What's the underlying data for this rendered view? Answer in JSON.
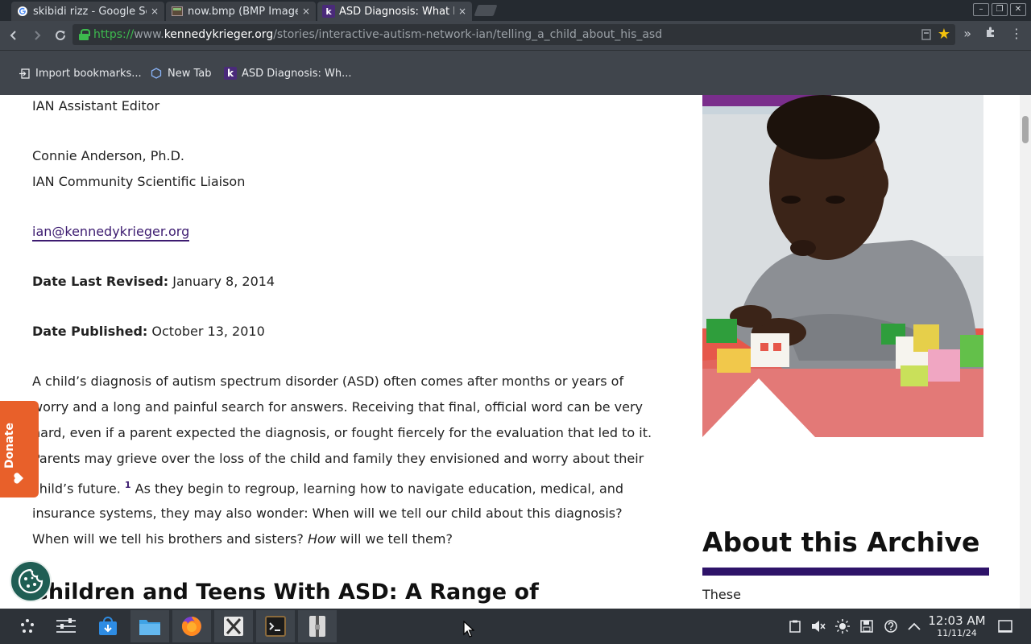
{
  "tabs": [
    {
      "title": "skibidi rizz - Google Se",
      "icon": "google-icon",
      "close": "×"
    },
    {
      "title": "now.bmp (BMP Image",
      "icon": "image-file-icon",
      "close": "×"
    },
    {
      "title": "ASD Diagnosis: What I",
      "icon": "kennedy-krieger-icon",
      "icon_glyph": "k",
      "close": "×"
    }
  ],
  "window_controls": {
    "minimize": "–",
    "restore": "❐",
    "close": "✕"
  },
  "address_bar": {
    "scheme": "https://",
    "domain_prefix": "www.",
    "domain": "kennedykrieger.org",
    "path": "/stories/interactive-autism-network-ian/telling_a_child_about_his_asd"
  },
  "bookmarks": [
    {
      "label": "Import bookmarks...",
      "icon": "import-icon"
    },
    {
      "label": "New Tab",
      "icon": "new-tab-icon"
    },
    {
      "label": "ASD Diagnosis: Wh...",
      "icon": "kennedy-krieger-icon",
      "icon_glyph": "k"
    }
  ],
  "article": {
    "editor_role": "IAN Assistant Editor",
    "author_name": "Connie Anderson, Ph.D.",
    "author_role": "IAN Community Scientific Liaison",
    "email": "ian@kennedykrieger.org",
    "revised_label": "Date Last Revised:",
    "revised_value": " January 8, 2014",
    "published_label": "Date Published:",
    "published_value": " October 13, 2010",
    "body_lines": [
      "A child’s diagnosis of autism spectrum disorder (ASD) often comes after months or years of",
      "worry and a long and painful search for answers. Receiving that final, official word can be very",
      "hard, even if a parent expected the diagnosis, or fought fiercely for the evaluation that led to it.",
      "Parents may grieve over the loss of the child and family they envisioned and worry about their"
    ],
    "line5_before": "child’s future. ",
    "footnote": "1",
    "line5_after": " As they begin to regroup, learning how to navigate education, medical, and",
    "line6": "insurance systems, they may also wonder: When will we tell our child about this diagnosis?",
    "line7_before": "When will we tell his brothers and sisters? ",
    "line7_italic": "How",
    "line7_after": "  will we tell them?",
    "section_heading": "Children and Teens With ASD: A Range of"
  },
  "sidebar": {
    "about_title": "About this Archive",
    "about_text": "These"
  },
  "donate_label": "Donate",
  "taskbar": {
    "apps": [
      "app-launcher-icon",
      "system-settings-icon",
      "discover-store-icon",
      "file-manager-icon",
      "firefox-icon",
      "xorg-icon",
      "terminal-icon",
      "archive-manager-icon"
    ],
    "time": "12:03 AM",
    "date": "11/11/24"
  },
  "colors": {
    "accent_purple": "#2e1369",
    "donate_orange": "#e8602a",
    "cookie_green": "#1f5e54"
  }
}
